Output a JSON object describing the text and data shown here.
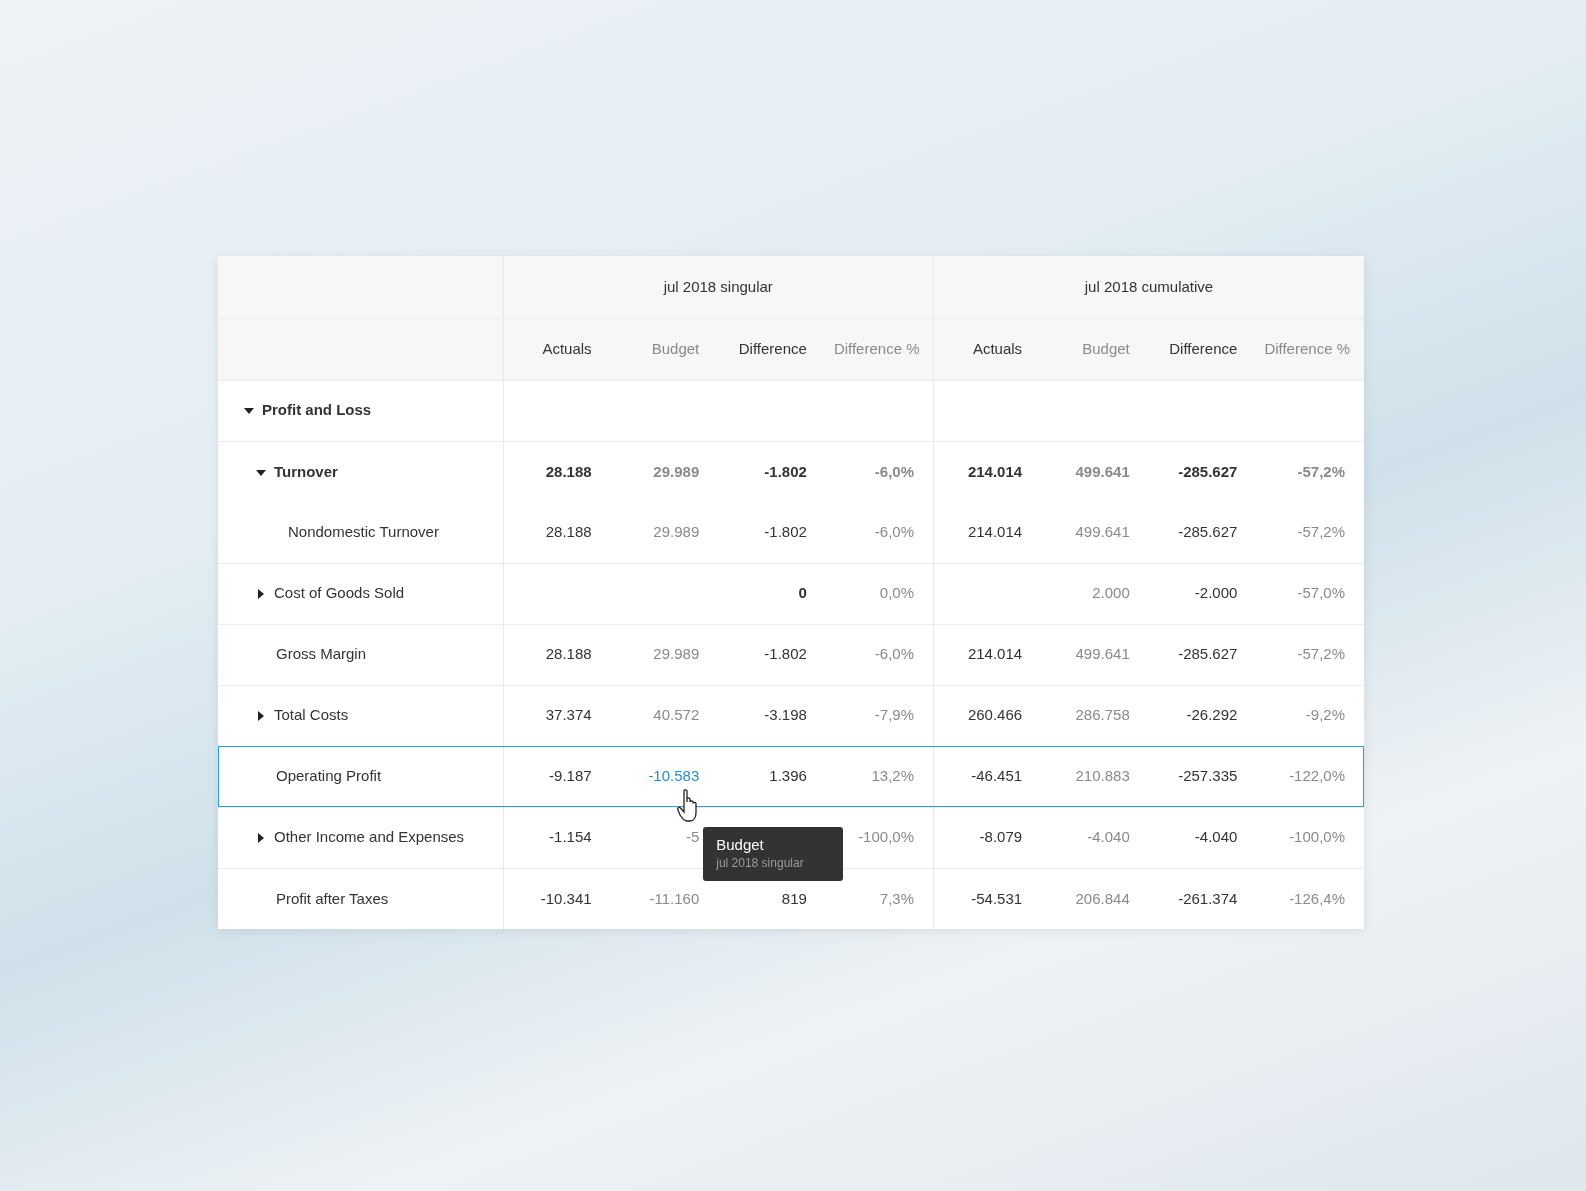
{
  "table": {
    "groups": [
      {
        "title": "jul 2018 singular",
        "kind": "singular",
        "columns": [
          {
            "label": "Actuals",
            "kind": "actuals"
          },
          {
            "label": "Budget",
            "kind": "budget"
          },
          {
            "label": "Difference",
            "kind": "difference"
          },
          {
            "label": "Difference %",
            "kind": "difference_pct"
          }
        ]
      },
      {
        "title": "jul 2018 cumulative",
        "kind": "cumulative",
        "columns": [
          {
            "label": "Actuals",
            "kind": "actuals"
          },
          {
            "label": "Budget",
            "kind": "budget"
          },
          {
            "label": "Difference",
            "kind": "difference"
          },
          {
            "label": "Difference %",
            "kind": "difference_pct"
          }
        ]
      }
    ],
    "rows": [
      {
        "label": "Profit and Loss",
        "bold": true,
        "expanded": true,
        "selected": false,
        "children": [
          {
            "label": "Turnover",
            "bold": true,
            "expanded": true,
            "selected": false,
            "values": {
              "singular": {
                "actuals": {
                  "text": "28.188",
                  "hovered": false
                },
                "budget": {
                  "text": "29.989",
                  "hovered": false
                },
                "difference": {
                  "text": "-1.802",
                  "hovered": false
                },
                "difference_pct": {
                  "text": "-6,0%",
                  "hovered": false
                }
              },
              "cumulative": {
                "actuals": {
                  "text": "214.014",
                  "hovered": false
                },
                "budget": {
                  "text": "499.641",
                  "hovered": false
                },
                "difference": {
                  "text": "-285.627",
                  "hovered": false
                },
                "difference_pct": {
                  "text": "-57,2%",
                  "hovered": false
                }
              }
            },
            "children": [
              {
                "label": "Nondomestic Turnover",
                "bold": false,
                "selected": false,
                "values": {
                  "singular": {
                    "actuals": {
                      "text": "28.188",
                      "hovered": false
                    },
                    "budget": {
                      "text": "29.989",
                      "hovered": false
                    },
                    "difference": {
                      "text": "-1.802",
                      "hovered": false
                    },
                    "difference_pct": {
                      "text": "-6,0%",
                      "hovered": false
                    }
                  },
                  "cumulative": {
                    "actuals": {
                      "text": "214.014",
                      "hovered": false
                    },
                    "budget": {
                      "text": "499.641",
                      "hovered": false
                    },
                    "difference": {
                      "text": "-285.627",
                      "hovered": false
                    },
                    "difference_pct": {
                      "text": "-57,2%",
                      "hovered": false
                    }
                  }
                }
              }
            ]
          },
          {
            "label": "Cost of Goods Sold",
            "bold": false,
            "expanded": false,
            "selected": false,
            "values": {
              "singular": {
                "difference": {
                  "text": "**0**",
                  "hovered": false
                },
                "difference_pct": {
                  "text": "0,0%",
                  "hovered": false
                }
              },
              "cumulative": {
                "budget": {
                  "text": "2.000",
                  "hovered": false
                },
                "difference": {
                  "text": "-2.000",
                  "hovered": false
                },
                "difference_pct": {
                  "text": "-57,0%",
                  "hovered": false
                }
              }
            }
          },
          {
            "label": "Gross Margin",
            "bold": false,
            "selected": false,
            "values": {
              "singular": {
                "actuals": {
                  "text": "28.188",
                  "hovered": false
                },
                "budget": {
                  "text": "29.989",
                  "hovered": false
                },
                "difference": {
                  "text": "-1.802",
                  "hovered": false
                },
                "difference_pct": {
                  "text": "-6,0%",
                  "hovered": false
                }
              },
              "cumulative": {
                "actuals": {
                  "text": "214.014",
                  "hovered": false
                },
                "budget": {
                  "text": "499.641",
                  "hovered": false
                },
                "difference": {
                  "text": "-285.627",
                  "hovered": false
                },
                "difference_pct": {
                  "text": "-57,2%",
                  "hovered": false
                }
              }
            }
          },
          {
            "label": "Total Costs",
            "bold": false,
            "expanded": false,
            "selected": false,
            "values": {
              "singular": {
                "actuals": {
                  "text": "37.374",
                  "hovered": false
                },
                "budget": {
                  "text": "40.572",
                  "hovered": false
                },
                "difference": {
                  "text": "-3.198",
                  "hovered": false
                },
                "difference_pct": {
                  "text": "-7,9%",
                  "hovered": false
                }
              },
              "cumulative": {
                "actuals": {
                  "text": "260.466",
                  "hovered": false
                },
                "budget": {
                  "text": "286.758",
                  "hovered": false
                },
                "difference": {
                  "text": "-26.292",
                  "hovered": false
                },
                "difference_pct": {
                  "text": "-9,2%",
                  "hovered": false
                }
              }
            }
          },
          {
            "label": "Operating Profit",
            "bold": false,
            "selected": true,
            "values": {
              "singular": {
                "actuals": {
                  "text": "-9.187",
                  "hovered": false
                },
                "budget": {
                  "text": "-10.583",
                  "hovered": true
                },
                "difference": {
                  "text": "1.396",
                  "hovered": false
                },
                "difference_pct": {
                  "text": "13,2%",
                  "hovered": false
                }
              },
              "cumulative": {
                "actuals": {
                  "text": "-46.451",
                  "hovered": false
                },
                "budget": {
                  "text": "210.883",
                  "hovered": false
                },
                "difference": {
                  "text": "-257.335",
                  "hovered": false
                },
                "difference_pct": {
                  "text": "-122,0%",
                  "hovered": false
                }
              }
            }
          },
          {
            "label": "Other Income and Expenses",
            "bold": false,
            "expanded": false,
            "selected": false,
            "values": {
              "singular": {
                "actuals": {
                  "text": "-1.154",
                  "hovered": false
                },
                "budget": {
                  "text": "-5",
                  "hovered": false
                },
                "difference_pct": {
                  "text": "-100,0%",
                  "hovered": false
                }
              },
              "cumulative": {
                "actuals": {
                  "text": "-8.079",
                  "hovered": false
                },
                "budget": {
                  "text": "-4.040",
                  "hovered": false
                },
                "difference": {
                  "text": "-4.040",
                  "hovered": false
                },
                "difference_pct": {
                  "text": "-100,0%",
                  "hovered": false
                }
              }
            }
          },
          {
            "label": "Profit after Taxes",
            "bold": false,
            "selected": false,
            "values": {
              "singular": {
                "actuals": {
                  "text": "-10.341",
                  "hovered": false
                },
                "budget": {
                  "text": "-11.160",
                  "hovered": false
                },
                "difference": {
                  "text": "819",
                  "hovered": false
                },
                "difference_pct": {
                  "text": "7,3%",
                  "hovered": false
                }
              },
              "cumulative": {
                "actuals": {
                  "text": "-54.531",
                  "hovered": false
                },
                "budget": {
                  "text": "206.844",
                  "hovered": false
                },
                "difference": {
                  "text": "-261.374",
                  "hovered": false
                },
                "difference_pct": {
                  "text": "-126,4%",
                  "hovered": false
                }
              }
            }
          }
        ]
      }
    ]
  },
  "tooltip": {
    "title": "Budget",
    "subtitle": "jul 2018 singular"
  }
}
